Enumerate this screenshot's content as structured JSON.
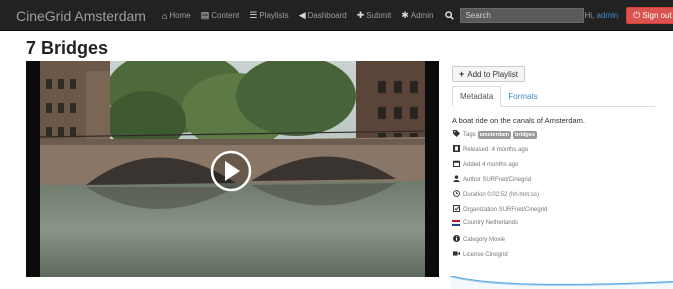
{
  "navbar": {
    "brand": "CineGrid Amsterdam",
    "items": [
      {
        "icon": "home-icon",
        "glyph": "⌂",
        "label": "Home"
      },
      {
        "icon": "content-icon",
        "glyph": "▤",
        "label": "Content"
      },
      {
        "icon": "playlists-icon",
        "glyph": "☰",
        "label": "Playlists"
      },
      {
        "icon": "dashboard-icon",
        "glyph": "◀",
        "label": "Dashboard"
      },
      {
        "icon": "plus-icon",
        "glyph": "✚",
        "label": "Submit"
      },
      {
        "icon": "gear-icon",
        "glyph": "✱",
        "label": "Admin"
      }
    ],
    "search_placeholder": "Search",
    "greeting": "Hi,",
    "username": "admin",
    "signout_label": "Sign out"
  },
  "page": {
    "title": "7 Bridges"
  },
  "sidebar": {
    "add_playlist_label": "Add to Playlist",
    "tabs": [
      "Metadata",
      "Formats"
    ],
    "description": "A boat ride on the canals of Amsterdam.",
    "tags_label": "Tags",
    "tags": [
      "amsterdam",
      "bridges"
    ],
    "released": "Released: 4 months ago",
    "added": "Added 4 months ago",
    "author": "Author SURFnet/Cinegrid",
    "duration": "Duration 0:02:52 (hh:mm:ss)",
    "organization": "Organization SURFnet/Cinegrid",
    "country": "Country Netherlands",
    "category": "Category Movie",
    "license": "License Cinegrid"
  },
  "colors": {
    "navbar_bg": "#222222",
    "link": "#428bca",
    "danger": "#d9534f",
    "flag": [
      "#ae1c28",
      "#ffffff",
      "#21468b"
    ]
  }
}
